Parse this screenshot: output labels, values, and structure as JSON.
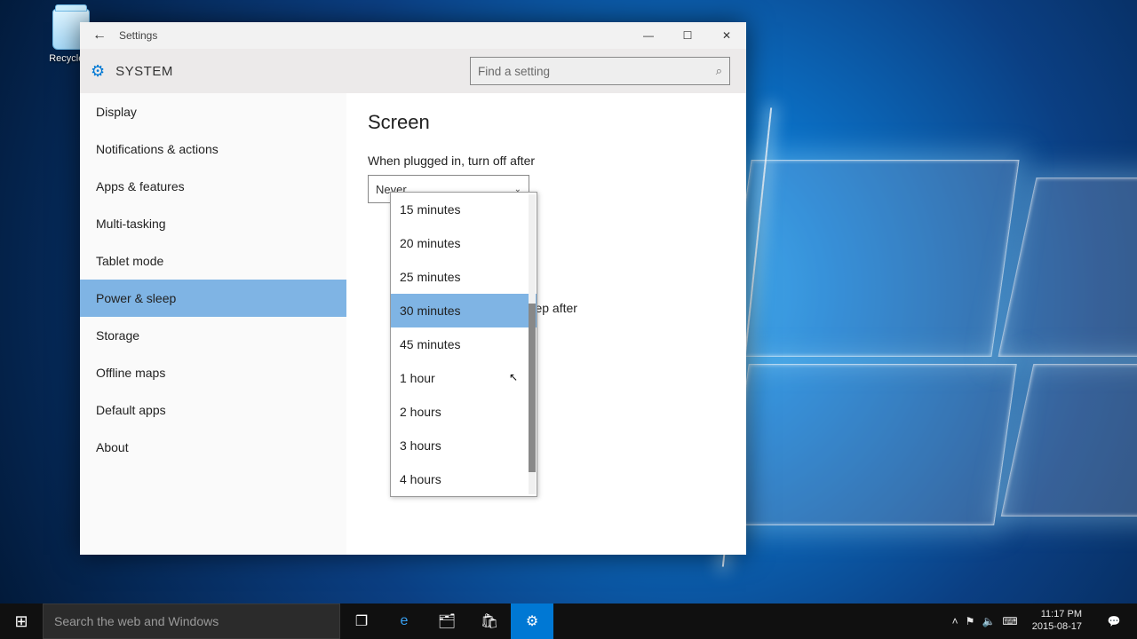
{
  "desktop": {
    "recycle_bin_label": "Recycle B"
  },
  "window": {
    "title": "Settings",
    "category": "SYSTEM",
    "search_placeholder": "Find a setting"
  },
  "sidebar": {
    "items": [
      {
        "label": "Display"
      },
      {
        "label": "Notifications & actions"
      },
      {
        "label": "Apps & features"
      },
      {
        "label": "Multi-tasking"
      },
      {
        "label": "Tablet mode"
      },
      {
        "label": "Power & sleep"
      },
      {
        "label": "Storage"
      },
      {
        "label": "Offline maps"
      },
      {
        "label": "Default apps"
      },
      {
        "label": "About"
      }
    ],
    "selected_index": 5
  },
  "content": {
    "heading": "Screen",
    "screen_label": "When plugged in, turn off after",
    "screen_value": "Never",
    "sleep_label_partial": "to sleep after"
  },
  "dropdown": {
    "options": [
      "15 minutes",
      "20 minutes",
      "25 minutes",
      "30 minutes",
      "45 minutes",
      "1 hour",
      "2 hours",
      "3 hours",
      "4 hours"
    ],
    "highlighted_index": 3
  },
  "taskbar": {
    "search_placeholder": "Search the web and Windows",
    "time": "11:17 PM",
    "date": "2015-08-17"
  }
}
